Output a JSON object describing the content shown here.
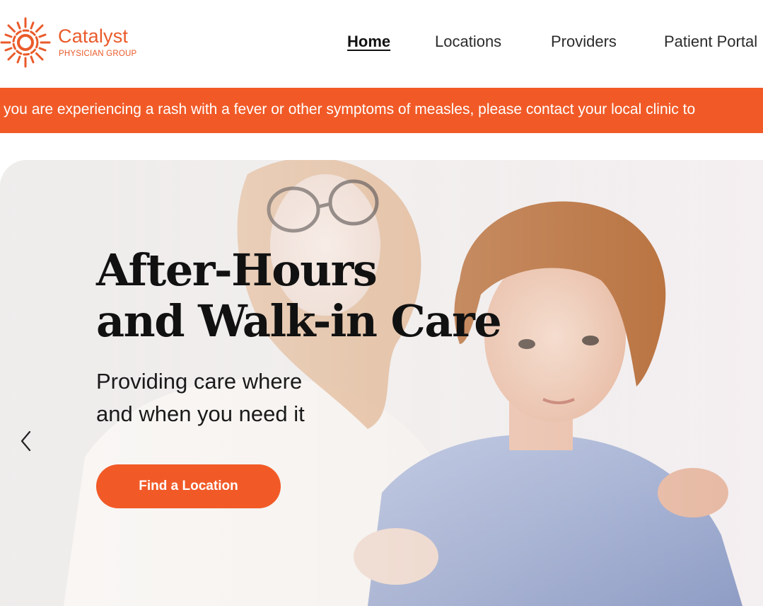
{
  "brand": {
    "name": "Catalyst",
    "tagline": "PHYSICIAN GROUP",
    "color": "#ea5a2a"
  },
  "nav": {
    "items": [
      {
        "label": "Home",
        "active": true
      },
      {
        "label": "Locations",
        "active": false
      },
      {
        "label": "Providers",
        "active": false
      },
      {
        "label": "Patient Portal",
        "active": false
      }
    ]
  },
  "alert": {
    "text": "you are experiencing a rash with a fever or other symptoms of measles, please contact your local clinic to",
    "background": "#f15a27"
  },
  "hero": {
    "title_line1": "After-Hours",
    "title_line2": "and Walk-in Care",
    "subtitle_line1": "Providing care where",
    "subtitle_line2": "and when you need it",
    "cta_label": "Find a Location",
    "cta_color": "#f15a27",
    "prev_icon": "chevron-left-icon"
  }
}
